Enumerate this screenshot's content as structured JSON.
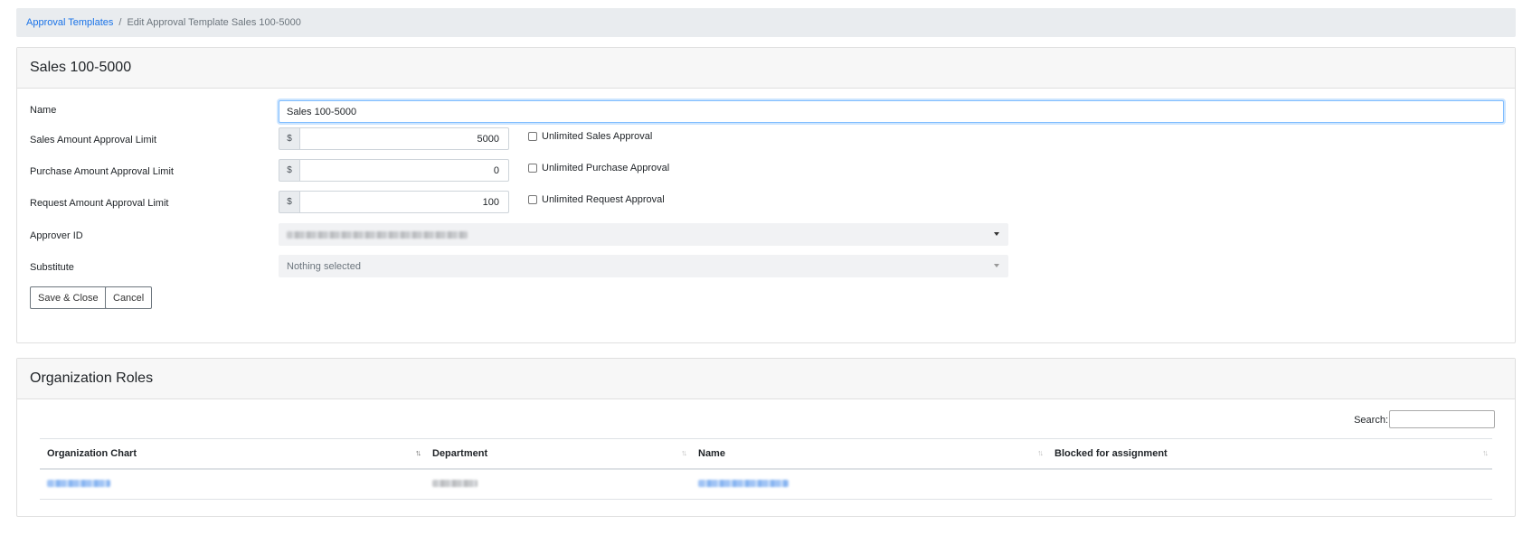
{
  "breadcrumb": {
    "parent": "Approval Templates",
    "separator": "/",
    "current": "Edit Approval Template Sales 100-5000"
  },
  "form_card": {
    "title": "Sales 100-5000",
    "name_label": "Name",
    "name_value": "Sales 100-5000",
    "sales_label": "Sales Amount Approval Limit",
    "sales_currency": "$",
    "sales_value": "5000",
    "sales_unlimited_label": "Unlimited Sales Approval",
    "purchase_label": "Purchase Amount Approval Limit",
    "purchase_currency": "$",
    "purchase_value": "0",
    "purchase_unlimited_label": "Unlimited Purchase Approval",
    "request_label": "Request Amount Approval Limit",
    "request_currency": "$",
    "request_value": "100",
    "request_unlimited_label": "Unlimited Request Approval",
    "approver_label": "Approver ID",
    "substitute_label": "Substitute",
    "substitute_placeholder": "Nothing selected",
    "save_label": "Save & Close",
    "cancel_label": "Cancel"
  },
  "roles_card": {
    "title": "Organization Roles",
    "search_label": "Search:",
    "columns": [
      "Organization Chart",
      "Department",
      "Name",
      "Blocked for assignment"
    ]
  },
  "colors": {
    "link": "#1a73e8",
    "header_bg": "#f7f7f7",
    "breadcrumb_bg": "#e9ecef",
    "focus_border": "#80bdff"
  },
  "icons": [
    "caret-down-icon",
    "sort-icon",
    "checkbox-icon"
  ]
}
